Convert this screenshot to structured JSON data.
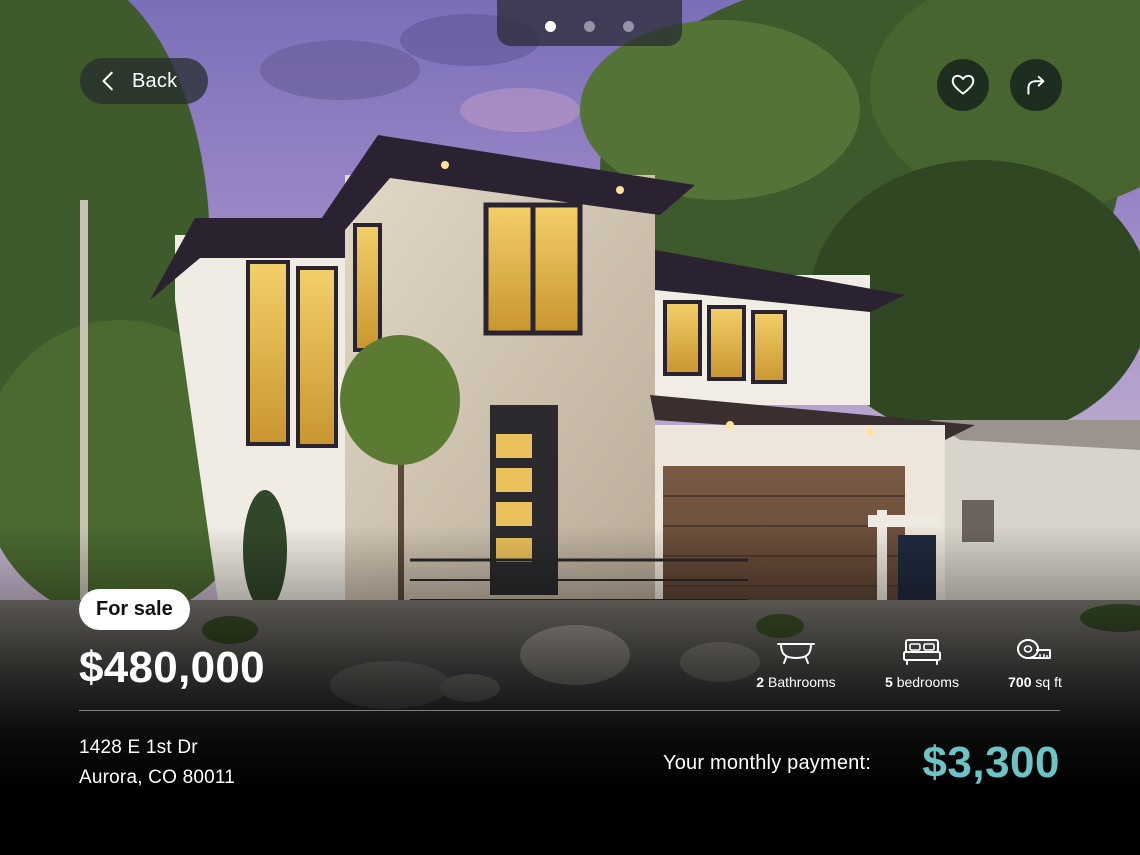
{
  "carousel": {
    "page_count": 3,
    "active_index": 0
  },
  "header": {
    "back_label": "Back",
    "favorite_icon": "heart-icon",
    "share_icon": "share-arrow-icon"
  },
  "listing": {
    "status_badge": "For sale",
    "price": "$480,000",
    "features": [
      {
        "icon": "bathtub-icon",
        "count": "2",
        "label": "Bathrooms"
      },
      {
        "icon": "bed-icon",
        "count": "5",
        "label": "bedrooms"
      },
      {
        "icon": "tape-measure-icon",
        "count": "700",
        "label": "sq ft"
      }
    ],
    "address_line1": "1428 E 1st Dr",
    "address_line2": "Aurora, CO 80011",
    "monthly_payment_label": "Your monthly payment:",
    "monthly_payment_value": "$3,300"
  },
  "colors": {
    "accent": "#6cc4c6",
    "badge_bg": "#ffffff",
    "overlay_button": "#1e2a28"
  }
}
